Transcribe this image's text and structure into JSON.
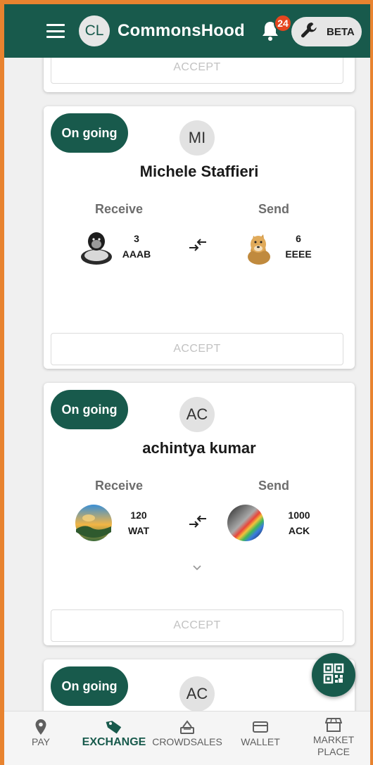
{
  "header": {
    "logo_initials": "CL",
    "app_name": "CommonsHood",
    "notification_count": "24",
    "beta_label": "BETA"
  },
  "accept_label": "ACCEPT",
  "cards": [
    {
      "status": "On going",
      "avatar_initials": "MI",
      "user_name": "Michele Staffieri",
      "receive_label": "Receive",
      "send_label": "Send",
      "receive_amount": "3",
      "receive_symbol": "AAAB",
      "receive_icon": "gorilla-token-icon",
      "send_amount": "6",
      "send_symbol": "EEEE",
      "send_icon": "dog-token-icon"
    },
    {
      "status": "On going",
      "avatar_initials": "AC",
      "user_name": "achintya kumar",
      "receive_label": "Receive",
      "send_label": "Send",
      "receive_amount": "120",
      "receive_symbol": "WAT",
      "receive_icon": "landscape-token-icon",
      "send_amount": "1000",
      "send_symbol": "ACK",
      "send_icon": "rainbow-token-icon"
    },
    {
      "status": "On going",
      "avatar_initials": "AC"
    }
  ],
  "bottom_nav": [
    {
      "label": "PAY",
      "icon": "location-pin-icon",
      "active": false
    },
    {
      "label": "EXCHANGE",
      "icon": "tag-icon",
      "active": true
    },
    {
      "label": "CROWDSALES",
      "icon": "ballot-icon",
      "active": false
    },
    {
      "label": "WALLET",
      "icon": "credit-card-icon",
      "active": false
    },
    {
      "label": "MARKET PLACE",
      "icon": "storefront-icon",
      "active": false
    }
  ],
  "colors": {
    "primary": "#185a4c",
    "badge": "#e5461f",
    "frame_accent": "#e8832f"
  }
}
